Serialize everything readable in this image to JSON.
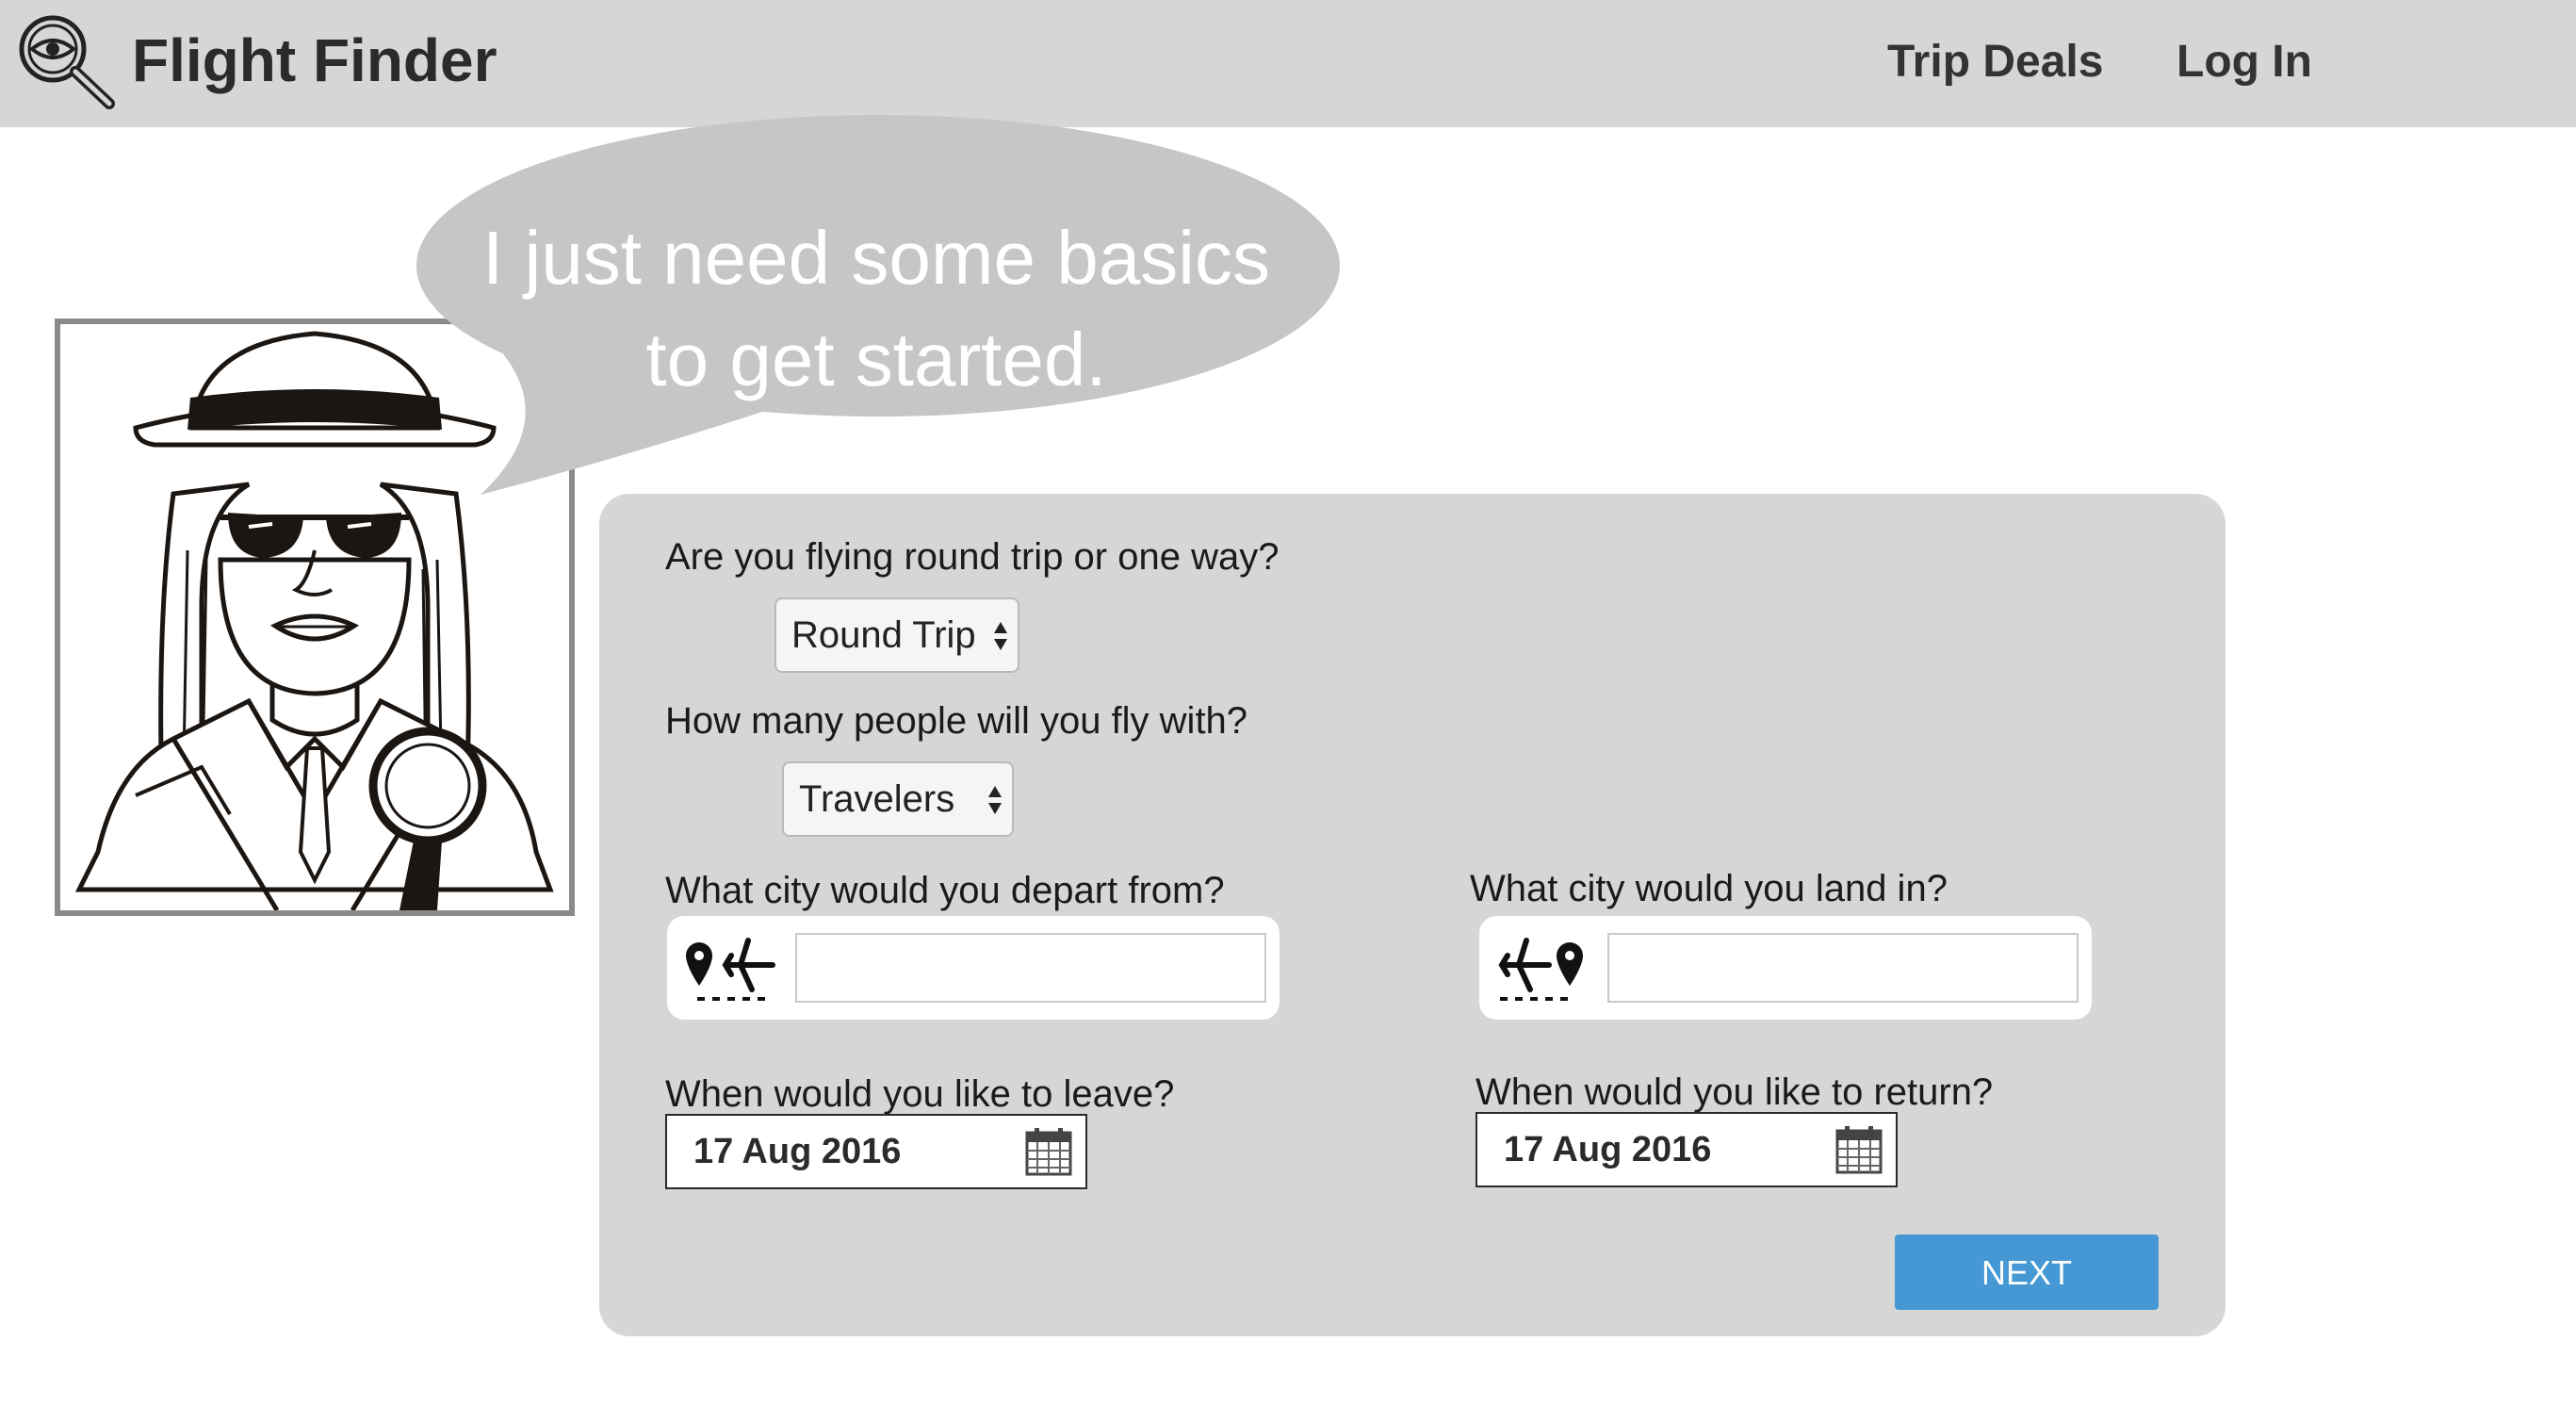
{
  "header": {
    "brand": "Flight Finder",
    "nav": {
      "trip_deals": "Trip Deals",
      "log_in": "Log In"
    }
  },
  "bubble": {
    "line1": "I just need some basics",
    "line2": "to get started."
  },
  "form": {
    "trip_type": {
      "question": "Are you flying round trip or one way?",
      "selected": "Round Trip"
    },
    "travelers": {
      "question": "How many people will you fly with?",
      "selected": "Travelers"
    },
    "depart_city": {
      "question": "What city would you depart from?",
      "value": ""
    },
    "arrive_city": {
      "question": "What city would you land in?",
      "value": ""
    },
    "leave_date": {
      "question": "When would you like to leave?",
      "value": "17 Aug 2016"
    },
    "return_date": {
      "question": "When would you like to return?",
      "value": "17 Aug 2016"
    },
    "next_label": "NEXT"
  },
  "colors": {
    "header_bg": "#d6d6d6",
    "panel_bg": "#d6d6d6",
    "accent": "#4598d3"
  },
  "icons": [
    "magnifier-eye-logo-icon",
    "detective-portrait",
    "depart-plane-icon",
    "arrive-plane-icon",
    "calendar-icon"
  ]
}
